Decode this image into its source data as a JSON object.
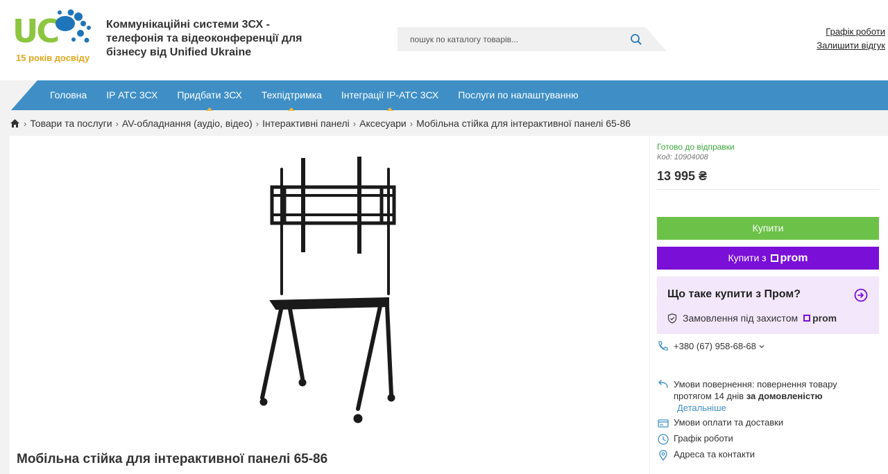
{
  "header": {
    "logo_text": "UC",
    "logo_tagline": "15 років досвіду",
    "site_title": "Коммунікаційні системи 3СХ - телефонія та відеоконференції для бізнесу від Unified Ukraine",
    "search_placeholder": "пошук по каталогу товарів...",
    "links": {
      "schedule": "Графік роботи",
      "review": "Залишити відгук"
    },
    "colors": {
      "logo_green": "#8cc63f",
      "logo_blue": "#1f75b9",
      "tagline": "#e0a81e"
    }
  },
  "nav": {
    "color": "#3f8fc6",
    "items": [
      {
        "label": "Головна",
        "marked": false
      },
      {
        "label": "IP АТС 3СХ",
        "marked": false
      },
      {
        "label": "Придбати 3СХ",
        "marked": true
      },
      {
        "label": "Техпідтримка",
        "marked": true
      },
      {
        "label": "Інтеграції IP-АТС 3СХ",
        "marked": true
      },
      {
        "label": "Послуги по налаштуванню",
        "marked": false
      }
    ]
  },
  "breadcrumbs": {
    "home_icon": "home-icon",
    "items": [
      "Товари та послуги",
      "AV-обладнання (аудіо, відео)",
      "Інтерактивні панелі",
      "Аксесуари",
      "Мобільна стійка для інтерактивної панелі 65-86"
    ]
  },
  "product": {
    "title": "Мобільна стійка для інтерактивної панелі 65-86",
    "image_icon": "mobile-tv-stand-image",
    "status": "Готово до відправки",
    "code": "Код: 10904008",
    "price": "13 995 ₴",
    "buy_label": "Купити",
    "buy_prom_label": "Купити з",
    "prom_brand": "prom",
    "colors": {
      "buy": "#6cc248",
      "prom": "#7a0fd8",
      "status": "#3aa53a"
    }
  },
  "prom_info": {
    "question": "Що таке купити з Пром?",
    "protection": "Замовлення під захистом",
    "brand": "prom"
  },
  "contacts": {
    "phone": "+380 (67) 958-68-68",
    "return_label": "Умови повернення:",
    "return_text": "повернення товару",
    "return_period": "протягом 14 днів",
    "return_bold": "за домовленістю",
    "return_more": "Детальніше",
    "payment": "Умови оплати та доставки",
    "schedule": "Графік роботи",
    "address": "Адреса та контакти"
  }
}
